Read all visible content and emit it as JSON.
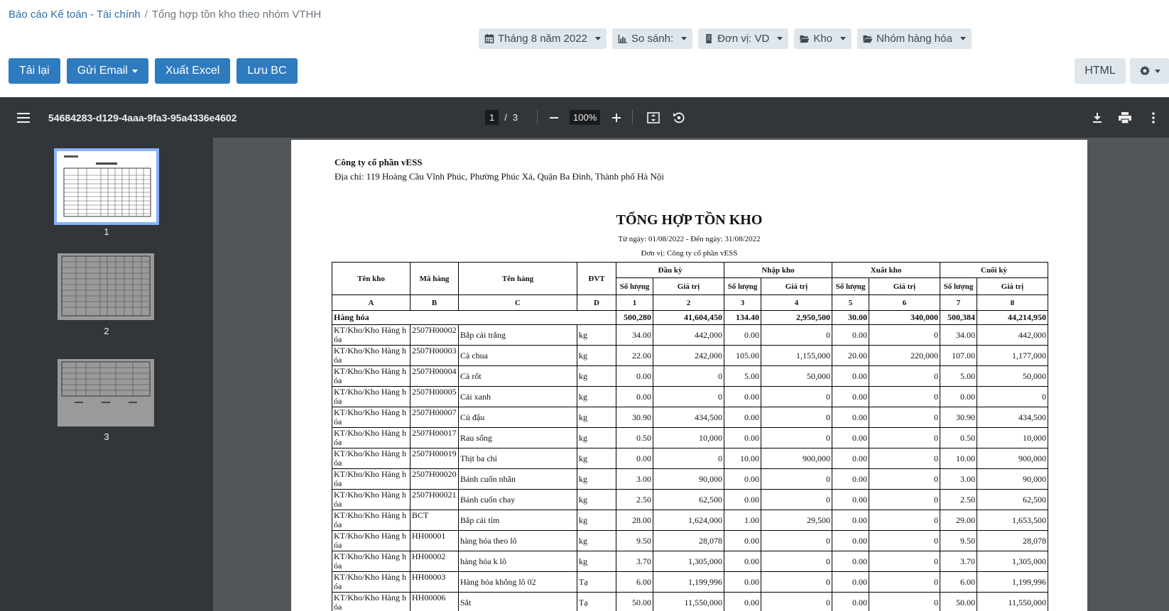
{
  "breadcrumb": {
    "root": "Báo cáo Kế toán - Tài chính",
    "separator": "/",
    "current": "Tổng hợp tồn kho theo nhóm VTHH"
  },
  "filters": [
    {
      "label": "Tháng 8 năm 2022",
      "icon": "calendar-icon"
    },
    {
      "label": "So sánh:",
      "icon": "bar-chart-icon"
    },
    {
      "label": "Đơn vị: VD",
      "icon": "building-icon"
    },
    {
      "label": "Kho",
      "icon": "folder-open-icon"
    },
    {
      "label": "Nhóm hàng hóa",
      "icon": "folder-open-icon"
    }
  ],
  "actions": {
    "reload": "Tải lại",
    "send_email": "Gửi Email",
    "export_excel": "Xuất Excel",
    "save_report": "Lưu BC",
    "html": "HTML"
  },
  "viewer": {
    "filename": "54684283-d129-4aaa-9fa3-95a4336e4602",
    "page_current": "1",
    "page_sep": "/",
    "page_total": "3",
    "zoom": "100%"
  },
  "thumbnails": [
    "1",
    "2",
    "3"
  ],
  "report": {
    "company": "Công ty cổ phần vESS",
    "address": "Địa chỉ: 119 Hoàng Cầu Vĩnh Phúc, Phường Phúc Xá, Quận Ba Đình, Thành phố Hà Nội",
    "title": "TỔNG HỢP TỒN KHO",
    "date_range": "Từ ngày: 01/08/2022 - Đến ngày: 31/08/2022",
    "unit": "Đơn vị: Công ty cổ phần vESS",
    "headers": {
      "warehouse": "Tên kho",
      "code": "Mã hàng",
      "name": "Tên hàng",
      "uom": "ĐVT",
      "opening": "Đầu kỳ",
      "receipt": "Nhập kho",
      "issue": "Xuất kho",
      "closing": "Cuối kỳ",
      "qty": "Số lượng",
      "value": "Giá trị"
    },
    "col_letters": [
      "A",
      "B",
      "C",
      "D",
      "1",
      "2",
      "3",
      "4",
      "5",
      "6",
      "7",
      "8"
    ],
    "group": {
      "name": "Hàng hóa",
      "values": [
        "500,280",
        "41,604,450",
        "134.40",
        "2,950,500",
        "30.00",
        "340,000",
        "500,384",
        "44,214,950"
      ]
    },
    "rows": [
      {
        "wh": "KT/Kho/Kho Hàng hóa",
        "code": "2507H00002",
        "name": "Bắp cải trắng",
        "uom": "kg",
        "v": [
          "34.00",
          "442,000",
          "0.00",
          "0",
          "0.00",
          "0",
          "34.00",
          "442,000"
        ]
      },
      {
        "wh": "KT/Kho/Kho Hàng hóa",
        "code": "2507H00003",
        "name": "Cà chua",
        "uom": "kg",
        "v": [
          "22.00",
          "242,000",
          "105.00",
          "1,155,000",
          "20.00",
          "220,000",
          "107.00",
          "1,177,000"
        ]
      },
      {
        "wh": "KT/Kho/Kho Hàng hóa",
        "code": "2507H00004",
        "name": "Cà rốt",
        "uom": "kg",
        "v": [
          "0.00",
          "0",
          "5.00",
          "50,000",
          "0.00",
          "0",
          "5.00",
          "50,000"
        ]
      },
      {
        "wh": "KT/Kho/Kho Hàng hóa",
        "code": "2507H00005",
        "name": "Cải xanh",
        "uom": "kg",
        "v": [
          "0.00",
          "0",
          "0.00",
          "0",
          "0.00",
          "0",
          "0.00",
          "0"
        ]
      },
      {
        "wh": "KT/Kho/Kho Hàng hóa",
        "code": "2507H00007",
        "name": "Củ đậu",
        "uom": "kg",
        "v": [
          "30.90",
          "434,500",
          "0.00",
          "0",
          "0.00",
          "0",
          "30.90",
          "434,500"
        ]
      },
      {
        "wh": "KT/Kho/Kho Hàng hóa",
        "code": "2507H00017",
        "name": "Rau sống",
        "uom": "kg",
        "v": [
          "0.50",
          "10,000",
          "0.00",
          "0",
          "0.00",
          "0",
          "0.50",
          "10,000"
        ]
      },
      {
        "wh": "KT/Kho/Kho Hàng hóa",
        "code": "2507H00019",
        "name": "Thịt ba chỉ",
        "uom": "kg",
        "v": [
          "0.00",
          "0",
          "10.00",
          "900,000",
          "0.00",
          "0",
          "10.00",
          "900,000"
        ]
      },
      {
        "wh": "KT/Kho/Kho Hàng hóa",
        "code": "2507H00020",
        "name": "Bánh cuốn nhân",
        "uom": "kg",
        "v": [
          "3.00",
          "90,000",
          "0.00",
          "0",
          "0.00",
          "0",
          "3.00",
          "90,000"
        ]
      },
      {
        "wh": "KT/Kho/Kho Hàng hóa",
        "code": "2507H00021",
        "name": "Bánh cuốn chay",
        "uom": "kg",
        "v": [
          "2.50",
          "62,500",
          "0.00",
          "0",
          "0.00",
          "0",
          "2.50",
          "62,500"
        ]
      },
      {
        "wh": "KT/Kho/Kho Hàng hóa",
        "code": "BCT",
        "name": "Bắp cải tím",
        "uom": "kg",
        "v": [
          "28.00",
          "1,624,000",
          "1.00",
          "29,500",
          "0.00",
          "0",
          "29.00",
          "1,653,500"
        ]
      },
      {
        "wh": "KT/Kho/Kho Hàng hóa",
        "code": "HH00001",
        "name": "hàng hóa theo lô",
        "uom": "kg",
        "v": [
          "9.50",
          "28,078",
          "0.00",
          "0",
          "0.00",
          "0",
          "9.50",
          "28,078"
        ]
      },
      {
        "wh": "KT/Kho/Kho Hàng hóa",
        "code": "HH00002",
        "name": "hàng hóa k lô",
        "uom": "kg",
        "v": [
          "3.70",
          "1,305,000",
          "0.00",
          "0",
          "0.00",
          "0",
          "3.70",
          "1,305,000"
        ]
      },
      {
        "wh": "KT/Kho/Kho Hàng hóa",
        "code": "HH00003",
        "name": "Hàng hóa không lô 02",
        "uom": "Tạ",
        "v": [
          "6.00",
          "1,199,996",
          "0.00",
          "0",
          "0.00",
          "0",
          "6.00",
          "1,199,996"
        ]
      },
      {
        "wh": "KT/Kho/Kho Hàng hóa",
        "code": "HH00006",
        "name": "Sắt",
        "uom": "Tạ",
        "v": [
          "50.00",
          "11,550,000",
          "0.00",
          "0",
          "0.00",
          "0",
          "50.00",
          "11,550,000"
        ]
      }
    ]
  }
}
